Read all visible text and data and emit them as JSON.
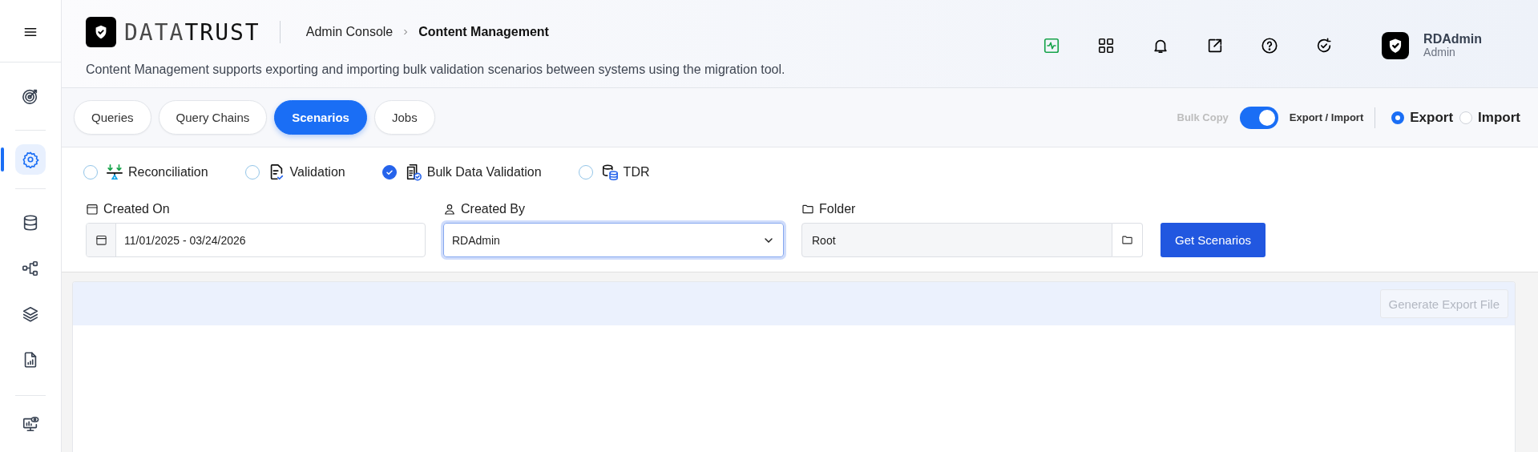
{
  "sidebar": {
    "groups": [
      {
        "items": [
          {
            "selected": false
          }
        ]
      },
      {
        "items": [
          {
            "selected": true
          }
        ]
      },
      {
        "items": [
          {
            "selected": false
          },
          {
            "selected": false
          },
          {
            "selected": false
          },
          {
            "selected": false
          }
        ]
      },
      {
        "items": [
          {
            "selected": false
          }
        ]
      }
    ]
  },
  "header": {
    "logo_text": "DATA**TRUST**",
    "breadcrumb": [
      "Admin Console",
      "Content Management"
    ],
    "description": "Content Management supports exporting and importing bulk validation scenarios between systems using the migration tool.",
    "user": {
      "name": "RDAdmin",
      "role": "Admin"
    }
  },
  "tabs": [
    {
      "label": "Queries",
      "selected": false
    },
    {
      "label": "Query Chains",
      "selected": false
    },
    {
      "label": "Scenarios",
      "selected": true
    },
    {
      "label": "Jobs",
      "selected": false
    }
  ],
  "bulk_toggle": {
    "off_label": "Bulk Copy",
    "on_label": "Export / Import",
    "on": true
  },
  "modes": [
    {
      "label": "Export",
      "selected": true
    },
    {
      "label": "Import",
      "selected": false
    }
  ],
  "scenario_types": [
    {
      "label": "Reconciliation",
      "selected": false
    },
    {
      "label": "Validation",
      "selected": false
    },
    {
      "label": "Bulk Data Validation",
      "selected": true
    },
    {
      "label": "TDR",
      "selected": false
    }
  ],
  "filters": {
    "created_on": {
      "label": "Created On",
      "value": "11/01/2025 - 03/24/2026"
    },
    "created_by": {
      "label": "Created By",
      "value": "RDAdmin"
    },
    "folder": {
      "label": "Folder",
      "value": "Root"
    },
    "button": "Get Scenarios"
  },
  "panel": {
    "button": {
      "label": "Generate Export File",
      "disabled": true
    }
  }
}
